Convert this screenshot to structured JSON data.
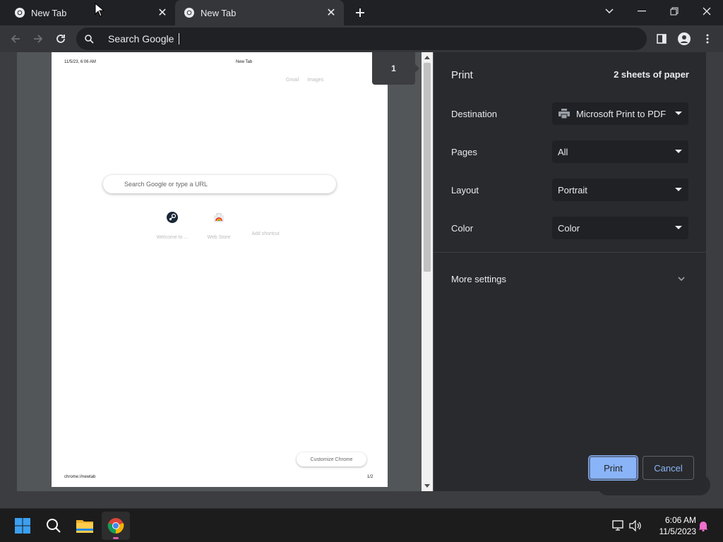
{
  "tabs": [
    {
      "title": "New Tab",
      "active": false
    },
    {
      "title": "New Tab",
      "active": true
    }
  ],
  "omnibox": {
    "text": "Search Google"
  },
  "preview": {
    "date": "11/5/23, 6:06 AM",
    "title": "New Tab",
    "links": [
      "Gmail",
      "Images"
    ],
    "search_placeholder": "Search Google or type a URL",
    "shortcuts": [
      {
        "label": "Welcome to ...",
        "icon": "steam-icon"
      },
      {
        "label": "Web Store",
        "icon": "webstore-icon"
      },
      {
        "label": "Add shortcut",
        "icon": "add-shortcut-icon"
      }
    ],
    "customize": "Customize Chrome",
    "url": "chrome://newtab",
    "page_count": "1/2",
    "page_badge": "1"
  },
  "print": {
    "title": "Print",
    "sheets": "2 sheets of paper",
    "rows": [
      {
        "label": "Destination",
        "value": "Microsoft Print to PDF",
        "icon": "printer-icon"
      },
      {
        "label": "Pages",
        "value": "All"
      },
      {
        "label": "Layout",
        "value": "Portrait"
      },
      {
        "label": "Color",
        "value": "Color"
      }
    ],
    "more_settings": "More settings",
    "print_button": "Print",
    "cancel_button": "Cancel"
  },
  "taskbar": {
    "time": "6:06 AM",
    "date": "11/5/2023",
    "apps": [
      "windows-start-icon",
      "search-icon",
      "file-explorer-icon",
      "chrome-icon"
    ]
  },
  "colors": {
    "accent": "#8ab4f8",
    "dialog_bg": "#292a2d",
    "preview_bg": "#525659",
    "select_bg": "#202124"
  }
}
